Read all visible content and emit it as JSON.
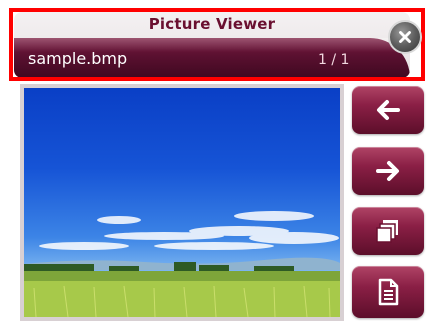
{
  "header": {
    "title": "Picture Viewer",
    "filename": "sample.bmp",
    "page_count": "1 / 1"
  },
  "icons": {
    "close": "close-icon",
    "prev": "arrow-left-icon",
    "next": "arrow-right-icon",
    "copy": "copy-icon",
    "info": "document-icon"
  },
  "colors": {
    "accent": "#6a1030",
    "button": "#8a1f45",
    "highlight_outline": "#ff0000"
  }
}
